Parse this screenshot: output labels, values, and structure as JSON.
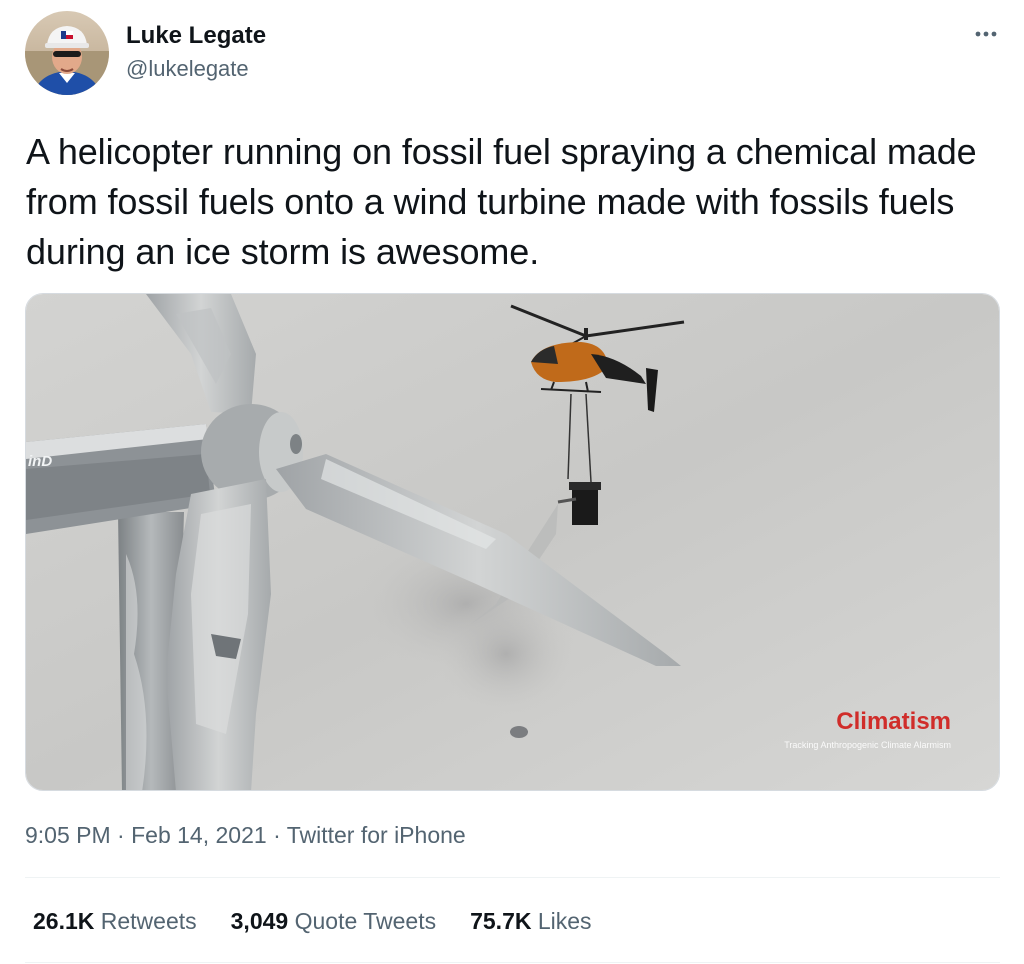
{
  "author": {
    "display_name": "Luke Legate",
    "handle": "@lukelegate",
    "avatar_icon": "profile-photo"
  },
  "more_icon": "ellipsis-icon",
  "tweet_text": "A helicopter running on fossil fuel spraying a chemical made from fossil fuels onto a wind turbine made with fossils fuels during an ice storm is awesome.",
  "media": {
    "turbine_text": "inD",
    "watermark_title": "Climatism",
    "watermark_subtitle": "Tracking Anthropogenic Climate Alarmism"
  },
  "meta": {
    "time": "9:05 PM",
    "date": "Feb 14, 2021",
    "separator": "·",
    "source": "Twitter for iPhone"
  },
  "stats": [
    {
      "count": "26.1K",
      "label": "Retweets"
    },
    {
      "count": "3,049",
      "label": "Quote Tweets"
    },
    {
      "count": "75.7K",
      "label": "Likes"
    }
  ],
  "colors": {
    "text": "#0f1419",
    "secondary": "#536471",
    "watermark_red": "#d02d2a"
  }
}
